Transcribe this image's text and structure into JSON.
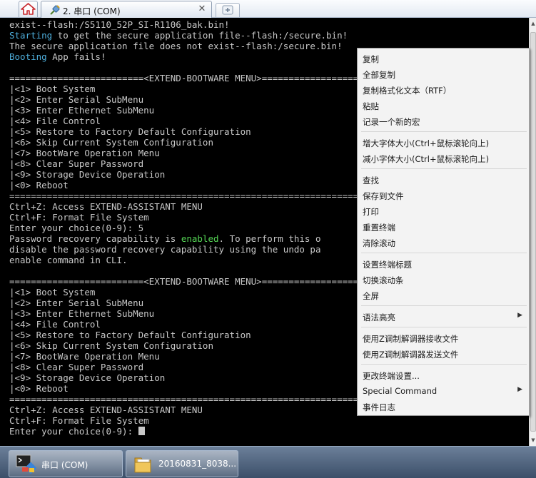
{
  "tabs": {
    "home_icon": "home-icon",
    "active_tab_label": "2. 串口 (COM)",
    "close_symbol": "✕",
    "newtab_icon": "new-tab-icon"
  },
  "terminal": {
    "lines": [
      {
        "text": "exist--flash:/S5110_52P_SI-R1106_bak.bin!"
      },
      {
        "pre": "Starting",
        "text": " to get the secure application file--flash:/secure.bin!"
      },
      {
        "text": "The secure application file does not exist--flash:/secure.bin!"
      },
      {
        "pre": "Booting",
        "text": " App fails!"
      },
      {
        "text": ""
      },
      {
        "text": "=========================<EXTEND-BOOTWARE MENU>=========================="
      },
      {
        "text": "|<1> Boot System"
      },
      {
        "text": "|<2> Enter Serial SubMenu"
      },
      {
        "text": "|<3> Enter Ethernet SubMenu"
      },
      {
        "text": "|<4> File Control"
      },
      {
        "text": "|<5> Restore to Factory Default Configuration"
      },
      {
        "text": "|<6> Skip Current System Configuration"
      },
      {
        "text": "|<7> BootWare Operation Menu"
      },
      {
        "text": "|<8> Clear Super Password"
      },
      {
        "text": "|<9> Storage Device Operation"
      },
      {
        "text": "|<0> Reboot"
      },
      {
        "text": "========================================================================="
      },
      {
        "text": "Ctrl+Z: Access EXTEND-ASSISTANT MENU"
      },
      {
        "text": "Ctrl+F: Format File System"
      },
      {
        "text": "Enter your choice(0-9): 5"
      },
      {
        "text": "Password recovery capability is ",
        "hl": "enabled",
        "post": ". To perform this o"
      },
      {
        "text": "disable the password recovery capability using the undo pa"
      },
      {
        "text": "enable command in CLI."
      },
      {
        "text": ""
      },
      {
        "text": "=========================<EXTEND-BOOTWARE MENU>=========================="
      },
      {
        "text": "|<1> Boot System"
      },
      {
        "text": "|<2> Enter Serial SubMenu"
      },
      {
        "text": "|<3> Enter Ethernet SubMenu"
      },
      {
        "text": "|<4> File Control"
      },
      {
        "text": "|<5> Restore to Factory Default Configuration"
      },
      {
        "text": "|<6> Skip Current System Configuration"
      },
      {
        "text": "|<7> BootWare Operation Menu"
      },
      {
        "text": "|<8> Clear Super Password"
      },
      {
        "text": "|<9> Storage Device Operation"
      },
      {
        "text": "|<0> Reboot"
      },
      {
        "text": "========================================================================="
      },
      {
        "text": "Ctrl+Z: Access EXTEND-ASSISTANT MENU"
      },
      {
        "text": "Ctrl+F: Format File System"
      },
      {
        "text": "Enter your choice(0-9): ",
        "cursor": true
      }
    ]
  },
  "context_menu": {
    "groups": [
      [
        {
          "label": "复制"
        },
        {
          "label": "全部复制"
        },
        {
          "label": "复制格式化文本（RTF）"
        },
        {
          "label": "粘贴"
        },
        {
          "label": "记录一个新的宏"
        }
      ],
      [
        {
          "label": "增大字体大小(Ctrl+鼠标滚轮向上)"
        },
        {
          "label": "减小字体大小(Ctrl+鼠标滚轮向上)"
        }
      ],
      [
        {
          "label": "查找"
        },
        {
          "label": "保存到文件"
        },
        {
          "label": "打印"
        },
        {
          "label": "重置终端"
        },
        {
          "label": "清除滚动"
        }
      ],
      [
        {
          "label": "设置终端标题"
        },
        {
          "label": "切换滚动条"
        },
        {
          "label": "全屏"
        }
      ],
      [
        {
          "label": "语法高亮",
          "submenu": true
        }
      ],
      [
        {
          "label": "使用Z调制解调器接收文件"
        },
        {
          "label": "使用Z调制解调器发送文件"
        }
      ],
      [
        {
          "label": "更改终端设置..."
        },
        {
          "label": "Special Command",
          "submenu": true
        },
        {
          "label": "事件日志"
        }
      ]
    ]
  },
  "taskbar": {
    "items": [
      {
        "label": "串口 (COM)",
        "icon": "terminal-app-icon"
      },
      {
        "label": "20160831_8038...",
        "icon": "folder-icon"
      }
    ]
  },
  "colors": {
    "terminal_bg": "#000000",
    "terminal_text": "#c8c8c8",
    "highlight_cyan": "#4eaedb",
    "highlight_green": "#54d454"
  }
}
